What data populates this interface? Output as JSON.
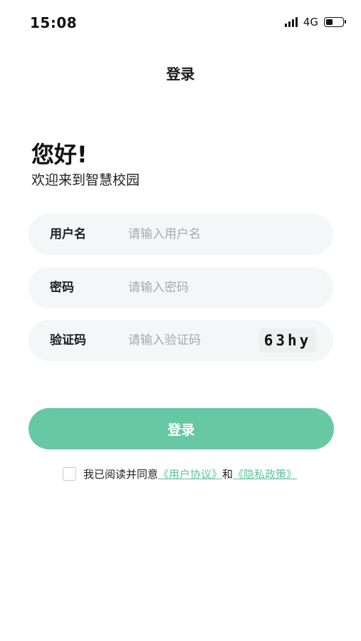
{
  "status_bar": {
    "time": "15:08",
    "network": "4G",
    "icons": [
      "signal-icon",
      "battery-icon"
    ]
  },
  "nav": {
    "title": "登录"
  },
  "greeting": {
    "title": "您好!",
    "subtitle": "欢迎来到智慧校园"
  },
  "form": {
    "username": {
      "label": "用户名",
      "placeholder": "请输入用户名",
      "value": ""
    },
    "password": {
      "label": "密码",
      "placeholder": "请输入密码",
      "value": ""
    },
    "captcha": {
      "label": "验证码",
      "placeholder": "请输入验证码",
      "value": "",
      "code": "63hy"
    }
  },
  "login_button": {
    "label": "登录"
  },
  "agreement": {
    "prefix": "我已阅读并同意",
    "user_agreement": "《用户协议》",
    "conjunction": "和",
    "privacy_policy": "《隐私政策》",
    "checked": false
  },
  "colors": {
    "accent": "#66c9a3",
    "link": "#5cc49c",
    "field_bg": "#f4f6f7",
    "placeholder": "#a7a9ab"
  }
}
